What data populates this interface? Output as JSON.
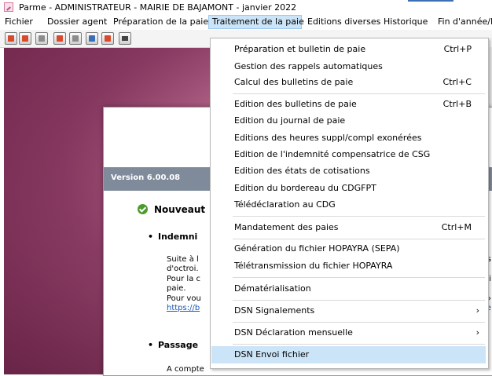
{
  "window": {
    "title": "Parme - ADMINISTRATEUR - MAIRIE DE BAJAMONT - janvier 2022",
    "app_icon": "parme-app-icon"
  },
  "menubar": {
    "items": [
      {
        "label": "Fichier"
      },
      {
        "label": "Dossier agent"
      },
      {
        "label": "Préparation de la paie"
      },
      {
        "label": "Traitement de la paie"
      },
      {
        "label": "Editions diverses"
      },
      {
        "label": "Historique"
      },
      {
        "label": "Fin d'année/D"
      }
    ],
    "active_index": 3
  },
  "toolbar": {
    "buttons": [
      "agent-icon",
      "agent-edit-icon",
      "calculator-icon",
      "agent-list-icon",
      "print-icon",
      "print-preview-icon",
      "print-batch-icon",
      "save-icon"
    ]
  },
  "document": {
    "version": "Version 6.00.08",
    "title": "Nouveaut",
    "bullet1": "Indemni",
    "lines": [
      "Suite à l",
      "d'octroi.",
      "Pour la c",
      "paie.",
      "Pour vou"
    ],
    "link": "https://b",
    "bullet2": "Passage",
    "last_line": "A compte",
    "right_fragments": [
      "s",
      "i",
      "›",
      "e"
    ]
  },
  "dropdown": {
    "items": [
      {
        "label": "Préparation et bulletin de paie",
        "shortcut": "Ctrl+P"
      },
      {
        "label": "Gestion des rappels automatiques",
        "shortcut": ""
      },
      {
        "label": "Calcul des bulletins de paie",
        "shortcut": "Ctrl+C"
      },
      {
        "label": "Edition des bulletins de paie",
        "shortcut": "Ctrl+B"
      },
      {
        "label": "Edition du journal de paie",
        "shortcut": ""
      },
      {
        "label": "Editions des heures suppl/compl exonérées",
        "shortcut": ""
      },
      {
        "label": "Edition de l'indemnité compensatrice de CSG",
        "shortcut": ""
      },
      {
        "label": "Edition des états de cotisations",
        "shortcut": ""
      },
      {
        "label": "Edition du bordereau du CDGFPT",
        "shortcut": ""
      },
      {
        "label": "Télédéclaration au CDG",
        "shortcut": ""
      },
      {
        "label": "Mandatement des paies",
        "shortcut": "Ctrl+M"
      },
      {
        "label": "Génération du fichier HOPAYRA (SEPA)",
        "shortcut": ""
      },
      {
        "label": "Télétransmission du fichier HOPAYRA",
        "shortcut": ""
      },
      {
        "label": "Dématérialisation",
        "shortcut": ""
      },
      {
        "label": "DSN Signalements",
        "submenu": "›"
      },
      {
        "label": "DSN Déclaration mensuelle",
        "submenu": "›"
      },
      {
        "label": "DSN Envoi fichier",
        "shortcut": ""
      }
    ],
    "highlighted_index": 16
  }
}
